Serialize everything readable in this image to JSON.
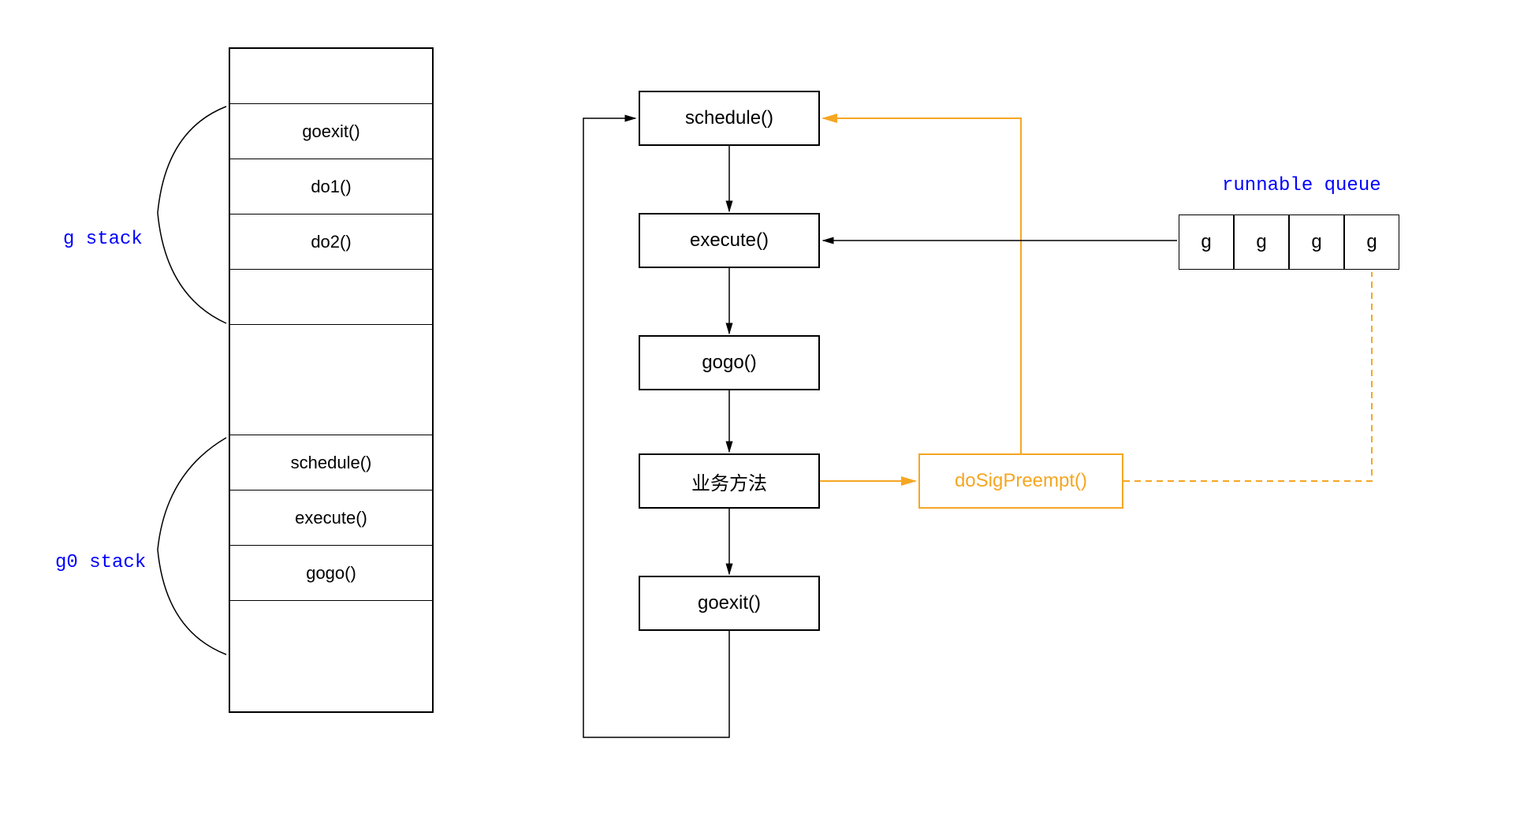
{
  "labels": {
    "g_stack": "g stack",
    "g0_stack": "g0 stack",
    "runnable_queue": "runnable queue"
  },
  "g_stack_rows": {
    "row0": "",
    "row1": "goexit()",
    "row2": "do1()",
    "row3": "do2()",
    "row4": "",
    "row5": "",
    "row6": "schedule()",
    "row7": "execute()",
    "row8": "gogo()",
    "row9": ""
  },
  "flow_boxes": {
    "schedule": "schedule()",
    "execute": "execute()",
    "gogo": "gogo()",
    "business": "业务方法",
    "dosigpreempt": "doSigPreempt()",
    "goexit": "goexit()"
  },
  "queue_cells": {
    "g1": "g",
    "g2": "g",
    "g3": "g",
    "g4": "g"
  },
  "colors": {
    "blue": "#0000ff",
    "orange": "#f5a623",
    "black": "#000000"
  }
}
